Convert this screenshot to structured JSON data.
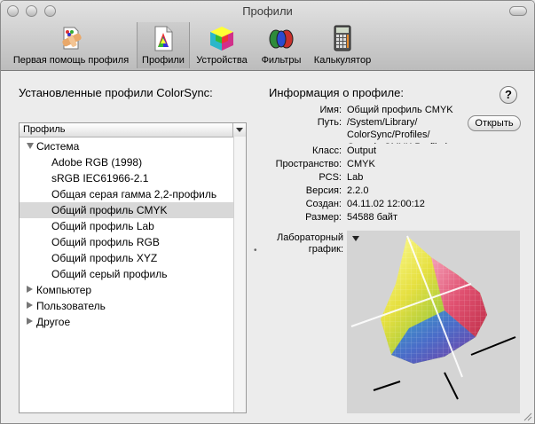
{
  "window": {
    "title": "Профили"
  },
  "toolbar": {
    "items": [
      {
        "label": "Первая помощь профиля",
        "icon": "first-aid-icon"
      },
      {
        "label": "Профили",
        "icon": "profiles-icon",
        "selected": true
      },
      {
        "label": "Устройства",
        "icon": "devices-icon"
      },
      {
        "label": "Фильтры",
        "icon": "filters-icon"
      },
      {
        "label": "Калькулятор",
        "icon": "calculator-icon"
      }
    ]
  },
  "left": {
    "title": "Установленные профили ColorSync:",
    "column_header": "Профиль",
    "tree": [
      {
        "label": "Система",
        "level": 0,
        "expanded": true
      },
      {
        "label": "Adobe RGB (1998)",
        "level": 1
      },
      {
        "label": "sRGB IEC61966-2.1",
        "level": 1
      },
      {
        "label": "Общая серая гамма 2,2-профиль",
        "level": 1
      },
      {
        "label": "Общий профиль CMYK",
        "level": 1,
        "selected": true
      },
      {
        "label": "Общий профиль Lab",
        "level": 1
      },
      {
        "label": "Общий профиль RGB",
        "level": 1
      },
      {
        "label": "Общий профиль XYZ",
        "level": 1
      },
      {
        "label": "Общий серый профиль",
        "level": 1
      },
      {
        "label": "Компьютер",
        "level": 0,
        "expanded": false
      },
      {
        "label": "Пользователь",
        "level": 0,
        "expanded": false
      },
      {
        "label": "Другое",
        "level": 0,
        "expanded": false
      }
    ]
  },
  "info": {
    "title": "Информация о профиле:",
    "help_label": "?",
    "name_label": "Имя:",
    "name_value": "Общий профиль CMYK",
    "path_label": "Путь:",
    "path_line1": "/System/Library/",
    "path_line2": "ColorSync/Profiles/",
    "path_line3": "Generic CMYK Profile.icc",
    "open_button": "Открыть",
    "class_label": "Класс:",
    "class_value": "Output",
    "space_label": "Пространство:",
    "space_value": "CMYK",
    "pcs_label": "PCS:",
    "pcs_value": "Lab",
    "version_label": "Версия:",
    "version_value": "2.2.0",
    "created_label": "Создан:",
    "created_value": "04.11.02 12:00:12",
    "size_label": "Размер:",
    "size_value": "54588 байт",
    "lab_graph_line1": "Лабораторный",
    "lab_graph_line2": "график:"
  },
  "colors": {
    "selection": "#d8d8d8",
    "window_bg": "#ececec",
    "graph_bg": "#d4d4d4"
  }
}
